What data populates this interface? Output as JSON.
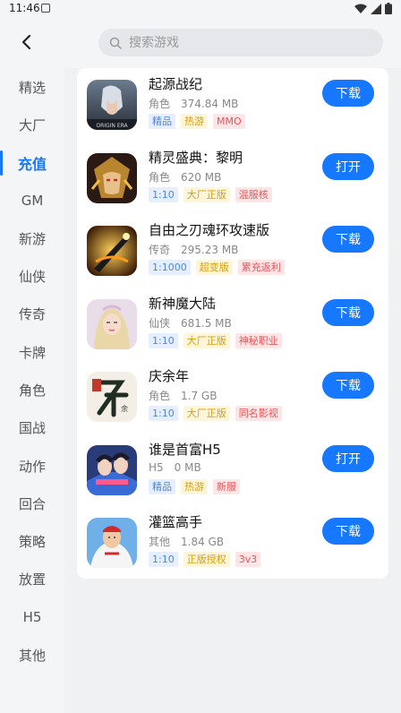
{
  "status_bar": {
    "time": "11:46"
  },
  "search": {
    "placeholder": "搜索游戏"
  },
  "sidebar": {
    "items": [
      {
        "label": "精选"
      },
      {
        "label": "大厂"
      },
      {
        "label": "充值",
        "active": true
      },
      {
        "label": "GM"
      },
      {
        "label": "新游"
      },
      {
        "label": "仙侠"
      },
      {
        "label": "传奇"
      },
      {
        "label": "卡牌"
      },
      {
        "label": "角色"
      },
      {
        "label": "国战"
      },
      {
        "label": "动作"
      },
      {
        "label": "回合"
      },
      {
        "label": "策略"
      },
      {
        "label": "放置"
      },
      {
        "label": "H5"
      },
      {
        "label": "其他"
      }
    ]
  },
  "games": [
    {
      "name": "起源战纪",
      "category": "角色",
      "size": "374.84 MB",
      "tags": [
        "精品",
        "热游",
        "MMO"
      ],
      "button": "下载"
    },
    {
      "name": "精灵盛典：黎明",
      "category": "角色",
      "size": "620 MB",
      "tags": [
        "1:10",
        "大厂正版",
        "混服核"
      ],
      "button": "打开"
    },
    {
      "name": "自由之刃魂环攻速版",
      "category": "传奇",
      "size": "295.23 MB",
      "tags": [
        "1:1000",
        "超变版",
        "累充返利"
      ],
      "button": "下载"
    },
    {
      "name": "新神魔大陆",
      "category": "仙侠",
      "size": "681.5 MB",
      "tags": [
        "1:10",
        "大厂正版",
        "神秘职业"
      ],
      "button": "下载"
    },
    {
      "name": "庆余年",
      "category": "角色",
      "size": "1.7 GB",
      "tags": [
        "1:10",
        "大厂正版",
        "同名影视"
      ],
      "button": "下载"
    },
    {
      "name": "谁是首富H5",
      "category": "H5",
      "size": "0 MB",
      "tags": [
        "精品",
        "热游",
        "新服"
      ],
      "button": "打开"
    },
    {
      "name": "灌篮高手",
      "category": "其他",
      "size": "1.84 GB",
      "tags": [
        "1:10",
        "正版授权",
        "3v3"
      ],
      "button": "下载"
    }
  ],
  "icon_themes": [
    "origin",
    "elf",
    "blade",
    "goddess",
    "qingyunian",
    "richman",
    "basketball"
  ],
  "colors": {
    "accent": "#1677ff",
    "tag_blue": "#4d86e0",
    "tag_yellow": "#d4a017",
    "tag_red": "#e0585b"
  }
}
